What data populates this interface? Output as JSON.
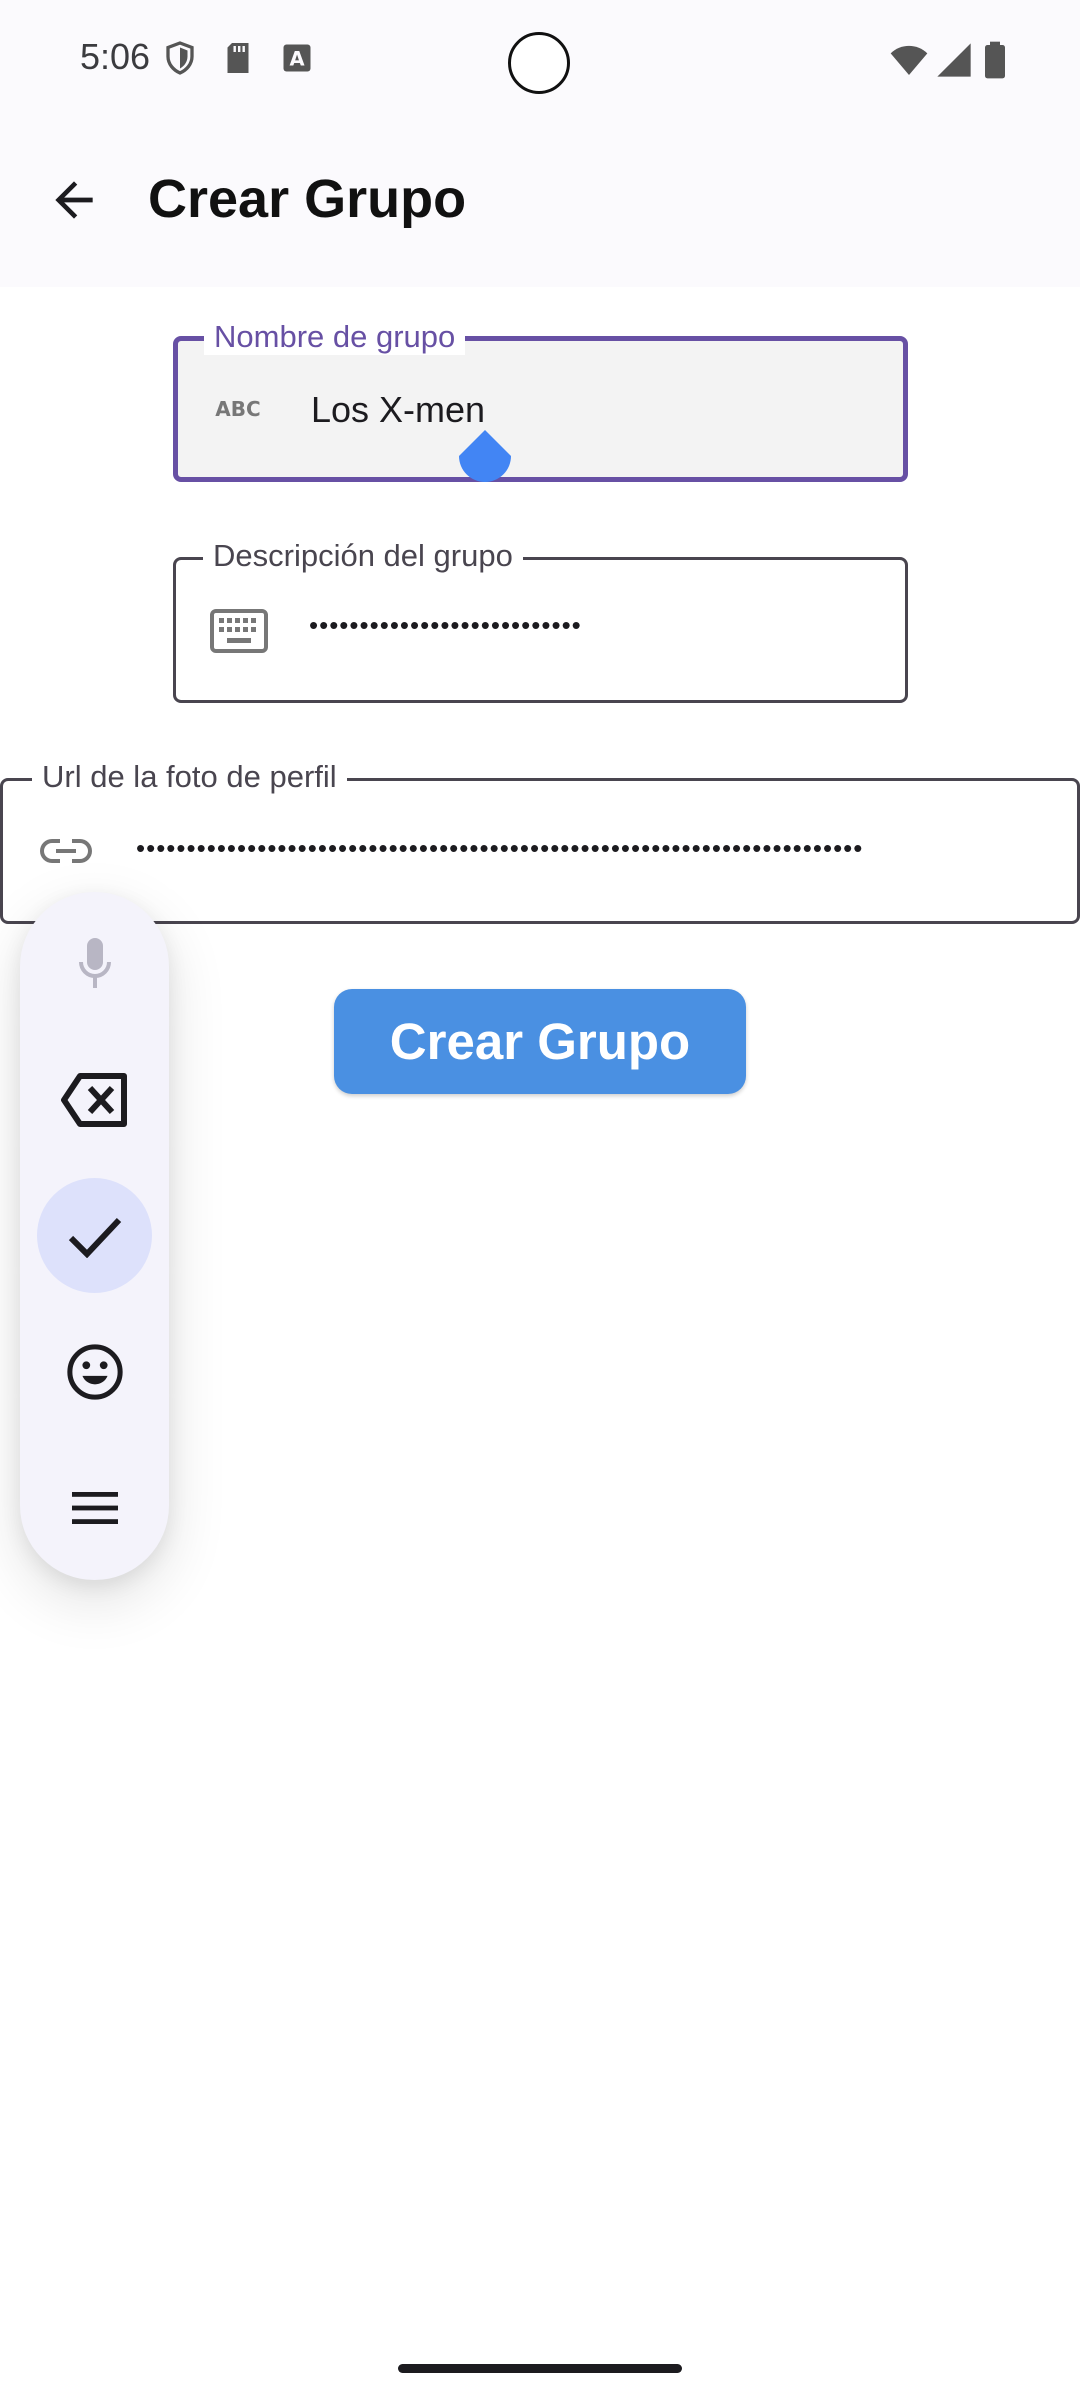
{
  "status_bar": {
    "time": "5:06",
    "icons": [
      "shield-icon",
      "sd-card-icon",
      "keyboard-a-icon",
      "wifi-icon",
      "signal-icon",
      "battery-icon"
    ]
  },
  "app_bar": {
    "title": "Crear Grupo",
    "back_icon": "arrow-back-icon"
  },
  "form": {
    "group_name": {
      "label": "Nombre de grupo",
      "value": "Los X-men",
      "icon": "abc-icon"
    },
    "group_description": {
      "label": "Descripción del grupo",
      "value": "•••••••••••••••••••••••••••",
      "icon": "keyboard-icon"
    },
    "profile_photo_url": {
      "label": "Url de la foto de perfil",
      "value": "••••••••••••••••••••••••••••••••••••••••••••••••••••••••••••••••••••••••",
      "icon": "link-icon"
    },
    "submit_label": "Crear Grupo"
  },
  "keyboard_toolbar": {
    "items": [
      "microphone-icon",
      "backspace-icon",
      "check-icon",
      "emoji-icon",
      "menu-icon"
    ]
  },
  "colors": {
    "accent": "#6750a4",
    "button": "#4a90e2",
    "toolbar_bg": "#f4f3fb",
    "toolbar_active": "#dde1fb"
  }
}
